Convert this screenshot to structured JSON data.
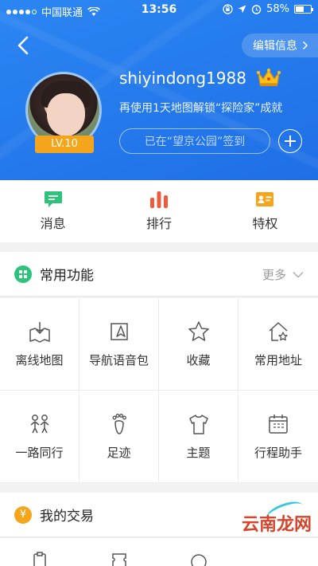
{
  "status_bar": {
    "carrier": "中国联通",
    "time": "13:56",
    "battery": "58%",
    "battery_level": 0.58
  },
  "header": {
    "edit_label": "编辑信息",
    "username": "shiyindong1988",
    "tagline": "再使用1天地图解锁“探险家”成就",
    "level": "LV.10",
    "checkin_text": "已在“望京公园”签到"
  },
  "quick_actions": [
    {
      "label": "消息",
      "icon": "message-icon",
      "color": "#2ec37a"
    },
    {
      "label": "排行",
      "icon": "ranking-icon",
      "color": "#f05a3c"
    },
    {
      "label": "特权",
      "icon": "privilege-card-icon",
      "color": "#f4a51c"
    }
  ],
  "common_functions": {
    "title": "常用功能",
    "more_label": "更多",
    "items": [
      {
        "label": "离线地图",
        "icon": "offline-map-icon"
      },
      {
        "label": "导航语音包",
        "icon": "voice-package-icon"
      },
      {
        "label": "收藏",
        "icon": "star-icon"
      },
      {
        "label": "常用地址",
        "icon": "home-star-icon"
      },
      {
        "label": "一路同行",
        "icon": "companions-icon"
      },
      {
        "label": "足迹",
        "icon": "footprint-icon"
      },
      {
        "label": "主题",
        "icon": "shirt-icon"
      },
      {
        "label": "行程助手",
        "icon": "calendar-icon"
      }
    ]
  },
  "trade": {
    "title": "我的交易",
    "currency_symbol": "¥"
  },
  "watermark": "云南龙网",
  "colors": {
    "header_blue": "#2079ec",
    "accent_green": "#2ec37a",
    "accent_orange": "#f4a51c"
  }
}
